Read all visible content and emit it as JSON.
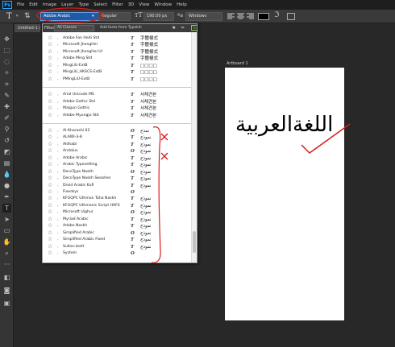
{
  "app": {
    "logo": "Ps"
  },
  "menu": [
    "File",
    "Edit",
    "Image",
    "Layer",
    "Type",
    "Select",
    "Filter",
    "3D",
    "View",
    "Window",
    "Help"
  ],
  "options_bar": {
    "font_family": "Adobe Arabic",
    "font_style": "Regular",
    "font_size": "190.00 px",
    "antialias": "Windows",
    "text_color": "#000000"
  },
  "document": {
    "tab_title": "Untitled-1 @",
    "artboard_label": "Artboard 1",
    "text": "اللغةالعربية"
  },
  "font_panel": {
    "filter_label": "Filter:",
    "filter_class": "All Classes",
    "typekit_label": "Add fonts from Typekit:",
    "typekit_icon": "Tk",
    "groups": [
      [
        {
          "name": "Adobe Fan Heiti Std",
          "sample": "字體樣式"
        },
        {
          "name": "Microsoft JhengHei",
          "sample": "字體樣式"
        },
        {
          "name": "Microsoft JhengHei UI",
          "sample": "字體樣式"
        },
        {
          "name": "Adobe Ming Std",
          "sample": "字體樣式"
        },
        {
          "name": "MingLiU-ExtB",
          "sample": "□□□□"
        },
        {
          "name": "MingLiU_HKSCS-ExtB",
          "sample": "□□□□"
        },
        {
          "name": "PMingLiU-ExtB",
          "sample": "□□□□"
        }
      ],
      [
        {
          "name": "Arial Unicode MS",
          "sample": "서체견본"
        },
        {
          "name": "Adobe Gothic Std",
          "sample": "서체견본"
        },
        {
          "name": "Malgun Gothic",
          "sample": "서체견본"
        },
        {
          "name": "Adobe Myungjo Std",
          "sample": "서체견본"
        }
      ],
      [
        {
          "name": "Al-Kharashi 62",
          "sample": "نمذج"
        },
        {
          "name": "ALAWI-3-8",
          "sample": "نموذج"
        },
        {
          "name": "Aldhabi",
          "sample": "نموذج"
        },
        {
          "name": "Andalus",
          "sample": "نموذج"
        },
        {
          "name": "Adobe Arabic",
          "sample": "نموذج"
        },
        {
          "name": "Arabic Typesetting",
          "sample": "نموذج"
        },
        {
          "name": "DecoType Naskh",
          "sample": "نموذج"
        },
        {
          "name": "DecoType Naskh Swashes",
          "sample": "نموذج"
        },
        {
          "name": "Droid Arabic Kufi",
          "sample": "نموذج"
        },
        {
          "name": "Fixedsys",
          "sample": ""
        },
        {
          "name": "KFGQPC Uthman Taha Naskh",
          "sample": "نموذج"
        },
        {
          "name": "KFGQPC Uthmanic Script HAFS",
          "sample": "نموذج"
        },
        {
          "name": "Microsoft Uighur",
          "sample": "نموذج"
        },
        {
          "name": "Myriad Arabic",
          "sample": "نموذج"
        },
        {
          "name": "Adobe Naskh",
          "sample": "نموذج"
        },
        {
          "name": "Simplified Arabic",
          "sample": "نموذج"
        },
        {
          "name": "Simplified Arabic Fixed",
          "sample": "نموذج"
        },
        {
          "name": "Sultan bold",
          "sample": "نموذج"
        },
        {
          "name": "System",
          "sample": ""
        }
      ]
    ]
  },
  "annotations": {
    "cross_mark": "X",
    "color": "#d91c1c"
  }
}
